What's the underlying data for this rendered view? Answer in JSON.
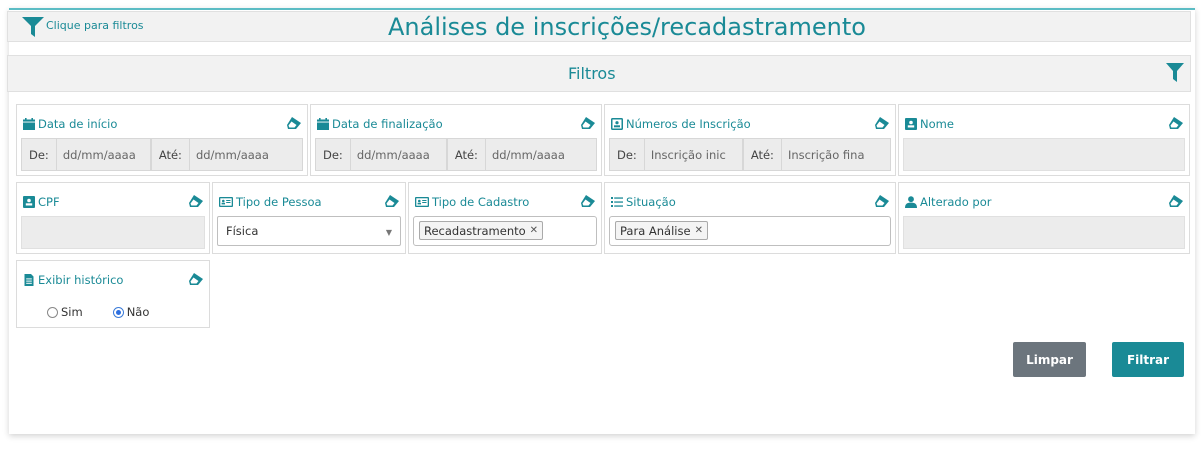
{
  "header": {
    "filter_link_label": "Clique para filtros",
    "page_title": "Análises de inscrições/recadastramento"
  },
  "filtros": {
    "title": "Filtros"
  },
  "fields": {
    "data_inicio": {
      "label": "Data de início",
      "de_label": "De:",
      "de_placeholder": "dd/mm/aaaa",
      "ate_label": "Até:",
      "ate_placeholder": "dd/mm/aaaa"
    },
    "data_finalizacao": {
      "label": "Data de finalização",
      "de_label": "De:",
      "de_placeholder": "dd/mm/aaaa",
      "ate_label": "Até:",
      "ate_placeholder": "dd/mm/aaaa"
    },
    "numeros_inscricao": {
      "label": "Números de Inscrição",
      "de_label": "De:",
      "de_placeholder": "Inscrição inic",
      "ate_label": "Até:",
      "ate_placeholder": "Inscrição fina"
    },
    "nome": {
      "label": "Nome"
    },
    "cpf": {
      "label": "CPF"
    },
    "tipo_pessoa": {
      "label": "Tipo de Pessoa",
      "selected": "Física"
    },
    "tipo_cadastro": {
      "label": "Tipo de Cadastro",
      "tags": [
        "Recadastramento"
      ]
    },
    "situacao": {
      "label": "Situação",
      "tags": [
        "Para Análise"
      ]
    },
    "alterado_por": {
      "label": "Alterado por"
    },
    "exibir_historico": {
      "label": "Exibir histórico",
      "options": [
        "Sim",
        "Não"
      ],
      "selected": "Não"
    }
  },
  "buttons": {
    "limpar": "Limpar",
    "filtrar": "Filtrar"
  },
  "colors": {
    "accent": "#1a8a96",
    "gray_button": "#6c757d",
    "radio_selected": "#2d6fe0"
  },
  "icons": {
    "filter": "funnel-icon",
    "date": "calendar-icon",
    "id": "id-card-icon",
    "list": "list-icon",
    "user": "user-icon",
    "document": "document-icon",
    "clear": "eraser-icon"
  }
}
